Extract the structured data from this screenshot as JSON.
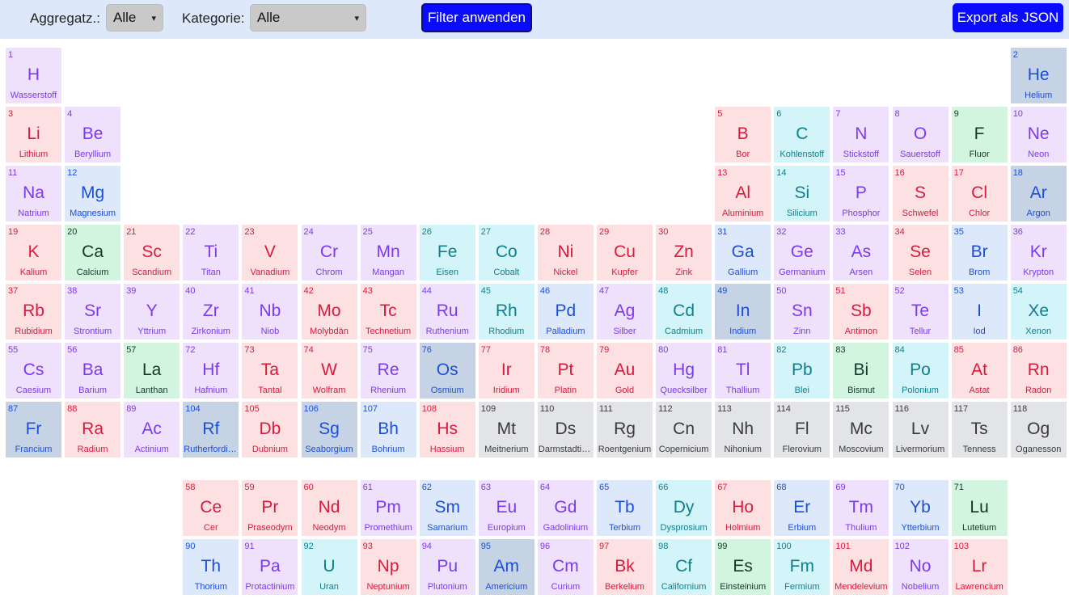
{
  "toolbar": {
    "state_label": "Aggregatz.:",
    "state_value": "Alle",
    "category_label": "Kategorie:",
    "category_value": "Alle",
    "filter_button": "Filter anwenden",
    "export_button": "Export als JSON"
  },
  "colors": {
    "toolbar_bg": "#dde8fb",
    "button_bg": "#0a0aff",
    "red": {
      "bg": "#fde0e2",
      "fg": "#d81b3c"
    },
    "purple": {
      "bg": "#efe0fb",
      "fg": "#7c3aed"
    },
    "blue": {
      "bg": "#dde9fb",
      "fg": "#1d4ed8"
    },
    "green": {
      "bg": "#d3f5e0",
      "fg": "#0f3a25"
    },
    "teal": {
      "bg": "#d3f5f9",
      "fg": "#0e7f8c"
    },
    "slate": {
      "bg": "#c6d3e4",
      "fg": "#1d4ed8"
    },
    "gray": {
      "bg": "#e3e4e8",
      "fg": "#3a3a3a"
    }
  },
  "elements": [
    {
      "n": 1,
      "sym": "H",
      "name": "Wasserstoff",
      "row": 1,
      "col": 1,
      "color": "purple"
    },
    {
      "n": 2,
      "sym": "He",
      "name": "Helium",
      "row": 1,
      "col": 18,
      "color": "slate"
    },
    {
      "n": 3,
      "sym": "Li",
      "name": "Lithium",
      "row": 2,
      "col": 1,
      "color": "red"
    },
    {
      "n": 4,
      "sym": "Be",
      "name": "Beryllium",
      "row": 2,
      "col": 2,
      "color": "purple"
    },
    {
      "n": 5,
      "sym": "B",
      "name": "Bor",
      "row": 2,
      "col": 13,
      "color": "red"
    },
    {
      "n": 6,
      "sym": "C",
      "name": "Kohlenstoff",
      "row": 2,
      "col": 14,
      "color": "teal"
    },
    {
      "n": 7,
      "sym": "N",
      "name": "Stickstoff",
      "row": 2,
      "col": 15,
      "color": "purple"
    },
    {
      "n": 8,
      "sym": "O",
      "name": "Sauerstoff",
      "row": 2,
      "col": 16,
      "color": "purple"
    },
    {
      "n": 9,
      "sym": "F",
      "name": "Fluor",
      "row": 2,
      "col": 17,
      "color": "green"
    },
    {
      "n": 10,
      "sym": "Ne",
      "name": "Neon",
      "row": 2,
      "col": 18,
      "color": "purple"
    },
    {
      "n": 11,
      "sym": "Na",
      "name": "Natrium",
      "row": 3,
      "col": 1,
      "color": "purple"
    },
    {
      "n": 12,
      "sym": "Mg",
      "name": "Magnesium",
      "row": 3,
      "col": 2,
      "color": "blue"
    },
    {
      "n": 13,
      "sym": "Al",
      "name": "Aluminium",
      "row": 3,
      "col": 13,
      "color": "red"
    },
    {
      "n": 14,
      "sym": "Si",
      "name": "Silicium",
      "row": 3,
      "col": 14,
      "color": "teal"
    },
    {
      "n": 15,
      "sym": "P",
      "name": "Phosphor",
      "row": 3,
      "col": 15,
      "color": "purple"
    },
    {
      "n": 16,
      "sym": "S",
      "name": "Schwefel",
      "row": 3,
      "col": 16,
      "color": "red"
    },
    {
      "n": 17,
      "sym": "Cl",
      "name": "Chlor",
      "row": 3,
      "col": 17,
      "color": "red"
    },
    {
      "n": 18,
      "sym": "Ar",
      "name": "Argon",
      "row": 3,
      "col": 18,
      "color": "slate"
    },
    {
      "n": 19,
      "sym": "K",
      "name": "Kalium",
      "row": 4,
      "col": 1,
      "color": "red"
    },
    {
      "n": 20,
      "sym": "Ca",
      "name": "Calcium",
      "row": 4,
      "col": 2,
      "color": "green"
    },
    {
      "n": 21,
      "sym": "Sc",
      "name": "Scandium",
      "row": 4,
      "col": 3,
      "color": "red"
    },
    {
      "n": 22,
      "sym": "Ti",
      "name": "Titan",
      "row": 4,
      "col": 4,
      "color": "purple"
    },
    {
      "n": 23,
      "sym": "V",
      "name": "Vanadium",
      "row": 4,
      "col": 5,
      "color": "red"
    },
    {
      "n": 24,
      "sym": "Cr",
      "name": "Chrom",
      "row": 4,
      "col": 6,
      "color": "purple"
    },
    {
      "n": 25,
      "sym": "Mn",
      "name": "Mangan",
      "row": 4,
      "col": 7,
      "color": "purple"
    },
    {
      "n": 26,
      "sym": "Fe",
      "name": "Eisen",
      "row": 4,
      "col": 8,
      "color": "teal"
    },
    {
      "n": 27,
      "sym": "Co",
      "name": "Cobalt",
      "row": 4,
      "col": 9,
      "color": "teal"
    },
    {
      "n": 28,
      "sym": "Ni",
      "name": "Nickel",
      "row": 4,
      "col": 10,
      "color": "red"
    },
    {
      "n": 29,
      "sym": "Cu",
      "name": "Kupfer",
      "row": 4,
      "col": 11,
      "color": "red"
    },
    {
      "n": 30,
      "sym": "Zn",
      "name": "Zink",
      "row": 4,
      "col": 12,
      "color": "red"
    },
    {
      "n": 31,
      "sym": "Ga",
      "name": "Gallium",
      "row": 4,
      "col": 13,
      "color": "blue"
    },
    {
      "n": 32,
      "sym": "Ge",
      "name": "Germanium",
      "row": 4,
      "col": 14,
      "color": "purple"
    },
    {
      "n": 33,
      "sym": "As",
      "name": "Arsen",
      "row": 4,
      "col": 15,
      "color": "purple"
    },
    {
      "n": 34,
      "sym": "Se",
      "name": "Selen",
      "row": 4,
      "col": 16,
      "color": "red"
    },
    {
      "n": 35,
      "sym": "Br",
      "name": "Brom",
      "row": 4,
      "col": 17,
      "color": "blue"
    },
    {
      "n": 36,
      "sym": "Kr",
      "name": "Krypton",
      "row": 4,
      "col": 18,
      "color": "purple"
    },
    {
      "n": 37,
      "sym": "Rb",
      "name": "Rubidium",
      "row": 5,
      "col": 1,
      "color": "red"
    },
    {
      "n": 38,
      "sym": "Sr",
      "name": "Strontium",
      "row": 5,
      "col": 2,
      "color": "purple"
    },
    {
      "n": 39,
      "sym": "Y",
      "name": "Yttrium",
      "row": 5,
      "col": 3,
      "color": "purple"
    },
    {
      "n": 40,
      "sym": "Zr",
      "name": "Zirkonium",
      "row": 5,
      "col": 4,
      "color": "purple"
    },
    {
      "n": 41,
      "sym": "Nb",
      "name": "Niob",
      "row": 5,
      "col": 5,
      "color": "purple"
    },
    {
      "n": 42,
      "sym": "Mo",
      "name": "Molybdän",
      "row": 5,
      "col": 6,
      "color": "red"
    },
    {
      "n": 43,
      "sym": "Tc",
      "name": "Technetium",
      "row": 5,
      "col": 7,
      "color": "red"
    },
    {
      "n": 44,
      "sym": "Ru",
      "name": "Ruthenium",
      "row": 5,
      "col": 8,
      "color": "purple"
    },
    {
      "n": 45,
      "sym": "Rh",
      "name": "Rhodium",
      "row": 5,
      "col": 9,
      "color": "teal"
    },
    {
      "n": 46,
      "sym": "Pd",
      "name": "Palladium",
      "row": 5,
      "col": 10,
      "color": "blue"
    },
    {
      "n": 47,
      "sym": "Ag",
      "name": "Silber",
      "row": 5,
      "col": 11,
      "color": "purple"
    },
    {
      "n": 48,
      "sym": "Cd",
      "name": "Cadmium",
      "row": 5,
      "col": 12,
      "color": "teal"
    },
    {
      "n": 49,
      "sym": "In",
      "name": "Indium",
      "row": 5,
      "col": 13,
      "color": "slate"
    },
    {
      "n": 50,
      "sym": "Sn",
      "name": "Zinn",
      "row": 5,
      "col": 14,
      "color": "purple"
    },
    {
      "n": 51,
      "sym": "Sb",
      "name": "Antimon",
      "row": 5,
      "col": 15,
      "color": "red"
    },
    {
      "n": 52,
      "sym": "Te",
      "name": "Tellur",
      "row": 5,
      "col": 16,
      "color": "purple"
    },
    {
      "n": 53,
      "sym": "I",
      "name": "Iod",
      "row": 5,
      "col": 17,
      "color": "blue"
    },
    {
      "n": 54,
      "sym": "Xe",
      "name": "Xenon",
      "row": 5,
      "col": 18,
      "color": "teal"
    },
    {
      "n": 55,
      "sym": "Cs",
      "name": "Caesium",
      "row": 6,
      "col": 1,
      "color": "purple"
    },
    {
      "n": 56,
      "sym": "Ba",
      "name": "Barium",
      "row": 6,
      "col": 2,
      "color": "purple"
    },
    {
      "n": 57,
      "sym": "La",
      "name": "Lanthan",
      "row": 6,
      "col": 3,
      "color": "green"
    },
    {
      "n": 72,
      "sym": "Hf",
      "name": "Hafnium",
      "row": 6,
      "col": 4,
      "color": "purple"
    },
    {
      "n": 73,
      "sym": "Ta",
      "name": "Tantal",
      "row": 6,
      "col": 5,
      "color": "red"
    },
    {
      "n": 74,
      "sym": "W",
      "name": "Wolfram",
      "row": 6,
      "col": 6,
      "color": "red"
    },
    {
      "n": 75,
      "sym": "Re",
      "name": "Rhenium",
      "row": 6,
      "col": 7,
      "color": "purple"
    },
    {
      "n": 76,
      "sym": "Os",
      "name": "Osmium",
      "row": 6,
      "col": 8,
      "color": "slate"
    },
    {
      "n": 77,
      "sym": "Ir",
      "name": "Iridium",
      "row": 6,
      "col": 9,
      "color": "red"
    },
    {
      "n": 78,
      "sym": "Pt",
      "name": "Platin",
      "row": 6,
      "col": 10,
      "color": "red"
    },
    {
      "n": 79,
      "sym": "Au",
      "name": "Gold",
      "row": 6,
      "col": 11,
      "color": "red"
    },
    {
      "n": 80,
      "sym": "Hg",
      "name": "Quecksilber",
      "row": 6,
      "col": 12,
      "color": "purple"
    },
    {
      "n": 81,
      "sym": "Tl",
      "name": "Thallium",
      "row": 6,
      "col": 13,
      "color": "purple"
    },
    {
      "n": 82,
      "sym": "Pb",
      "name": "Blei",
      "row": 6,
      "col": 14,
      "color": "teal"
    },
    {
      "n": 83,
      "sym": "Bi",
      "name": "Bismut",
      "row": 6,
      "col": 15,
      "color": "green"
    },
    {
      "n": 84,
      "sym": "Po",
      "name": "Polonium",
      "row": 6,
      "col": 16,
      "color": "teal"
    },
    {
      "n": 85,
      "sym": "At",
      "name": "Astat",
      "row": 6,
      "col": 17,
      "color": "red"
    },
    {
      "n": 86,
      "sym": "Rn",
      "name": "Radon",
      "row": 6,
      "col": 18,
      "color": "red"
    },
    {
      "n": 87,
      "sym": "Fr",
      "name": "Francium",
      "row": 7,
      "col": 1,
      "color": "slate"
    },
    {
      "n": 88,
      "sym": "Ra",
      "name": "Radium",
      "row": 7,
      "col": 2,
      "color": "red"
    },
    {
      "n": 89,
      "sym": "Ac",
      "name": "Actinium",
      "row": 7,
      "col": 3,
      "color": "purple"
    },
    {
      "n": 104,
      "sym": "Rf",
      "name": "Rutherfordium",
      "row": 7,
      "col": 4,
      "color": "slate"
    },
    {
      "n": 105,
      "sym": "Db",
      "name": "Dubnium",
      "row": 7,
      "col": 5,
      "color": "red"
    },
    {
      "n": 106,
      "sym": "Sg",
      "name": "Seaborgium",
      "row": 7,
      "col": 6,
      "color": "slate"
    },
    {
      "n": 107,
      "sym": "Bh",
      "name": "Bohrium",
      "row": 7,
      "col": 7,
      "color": "blue"
    },
    {
      "n": 108,
      "sym": "Hs",
      "name": "Hassium",
      "row": 7,
      "col": 8,
      "color": "red"
    },
    {
      "n": 109,
      "sym": "Mt",
      "name": "Meitnerium",
      "row": 7,
      "col": 9,
      "color": "gray"
    },
    {
      "n": 110,
      "sym": "Ds",
      "name": "Darmstadtium",
      "row": 7,
      "col": 10,
      "color": "gray"
    },
    {
      "n": 111,
      "sym": "Rg",
      "name": "Roentgenium",
      "row": 7,
      "col": 11,
      "color": "gray"
    },
    {
      "n": 112,
      "sym": "Cn",
      "name": "Copernicium",
      "row": 7,
      "col": 12,
      "color": "gray"
    },
    {
      "n": 113,
      "sym": "Nh",
      "name": "Nihonium",
      "row": 7,
      "col": 13,
      "color": "gray"
    },
    {
      "n": 114,
      "sym": "Fl",
      "name": "Flerovium",
      "row": 7,
      "col": 14,
      "color": "gray"
    },
    {
      "n": 115,
      "sym": "Mc",
      "name": "Moscovium",
      "row": 7,
      "col": 15,
      "color": "gray"
    },
    {
      "n": 116,
      "sym": "Lv",
      "name": "Livermorium",
      "row": 7,
      "col": 16,
      "color": "gray"
    },
    {
      "n": 117,
      "sym": "Ts",
      "name": "Tenness",
      "row": 7,
      "col": 17,
      "color": "gray"
    },
    {
      "n": 118,
      "sym": "Og",
      "name": "Oganesson",
      "row": 7,
      "col": 18,
      "color": "gray"
    },
    {
      "n": 58,
      "sym": "Ce",
      "name": "Cer",
      "row": 9,
      "col": 4,
      "color": "red"
    },
    {
      "n": 59,
      "sym": "Pr",
      "name": "Praseodym",
      "row": 9,
      "col": 5,
      "color": "red"
    },
    {
      "n": 60,
      "sym": "Nd",
      "name": "Neodym",
      "row": 9,
      "col": 6,
      "color": "red"
    },
    {
      "n": 61,
      "sym": "Pm",
      "name": "Promethium",
      "row": 9,
      "col": 7,
      "color": "purple"
    },
    {
      "n": 62,
      "sym": "Sm",
      "name": "Samarium",
      "row": 9,
      "col": 8,
      "color": "blue"
    },
    {
      "n": 63,
      "sym": "Eu",
      "name": "Europium",
      "row": 9,
      "col": 9,
      "color": "purple"
    },
    {
      "n": 64,
      "sym": "Gd",
      "name": "Gadolinium",
      "row": 9,
      "col": 10,
      "color": "purple"
    },
    {
      "n": 65,
      "sym": "Tb",
      "name": "Terbium",
      "row": 9,
      "col": 11,
      "color": "blue"
    },
    {
      "n": 66,
      "sym": "Dy",
      "name": "Dysprosium",
      "row": 9,
      "col": 12,
      "color": "teal"
    },
    {
      "n": 67,
      "sym": "Ho",
      "name": "Holmium",
      "row": 9,
      "col": 13,
      "color": "red"
    },
    {
      "n": 68,
      "sym": "Er",
      "name": "Erbium",
      "row": 9,
      "col": 14,
      "color": "blue"
    },
    {
      "n": 69,
      "sym": "Tm",
      "name": "Thulium",
      "row": 9,
      "col": 15,
      "color": "purple"
    },
    {
      "n": 70,
      "sym": "Yb",
      "name": "Ytterbium",
      "row": 9,
      "col": 16,
      "color": "blue"
    },
    {
      "n": 71,
      "sym": "Lu",
      "name": "Lutetium",
      "row": 9,
      "col": 17,
      "color": "green"
    },
    {
      "n": 90,
      "sym": "Th",
      "name": "Thorium",
      "row": 10,
      "col": 4,
      "color": "blue"
    },
    {
      "n": 91,
      "sym": "Pa",
      "name": "Protactinium",
      "row": 10,
      "col": 5,
      "color": "purple"
    },
    {
      "n": 92,
      "sym": "U",
      "name": "Uran",
      "row": 10,
      "col": 6,
      "color": "teal"
    },
    {
      "n": 93,
      "sym": "Np",
      "name": "Neptunium",
      "row": 10,
      "col": 7,
      "color": "red"
    },
    {
      "n": 94,
      "sym": "Pu",
      "name": "Plutonium",
      "row": 10,
      "col": 8,
      "color": "purple"
    },
    {
      "n": 95,
      "sym": "Am",
      "name": "Americium",
      "row": 10,
      "col": 9,
      "color": "slate"
    },
    {
      "n": 96,
      "sym": "Cm",
      "name": "Curium",
      "row": 10,
      "col": 10,
      "color": "purple"
    },
    {
      "n": 97,
      "sym": "Bk",
      "name": "Berkelium",
      "row": 10,
      "col": 11,
      "color": "red"
    },
    {
      "n": 98,
      "sym": "Cf",
      "name": "Californium",
      "row": 10,
      "col": 12,
      "color": "teal"
    },
    {
      "n": 99,
      "sym": "Es",
      "name": "Einsteinium",
      "row": 10,
      "col": 13,
      "color": "green"
    },
    {
      "n": 100,
      "sym": "Fm",
      "name": "Fermium",
      "row": 10,
      "col": 14,
      "color": "teal"
    },
    {
      "n": 101,
      "sym": "Md",
      "name": "Mendelevium",
      "row": 10,
      "col": 15,
      "color": "red"
    },
    {
      "n": 102,
      "sym": "No",
      "name": "Nobelium",
      "row": 10,
      "col": 16,
      "color": "purple"
    },
    {
      "n": 103,
      "sym": "Lr",
      "name": "Lawrencium",
      "row": 10,
      "col": 17,
      "color": "red"
    }
  ]
}
